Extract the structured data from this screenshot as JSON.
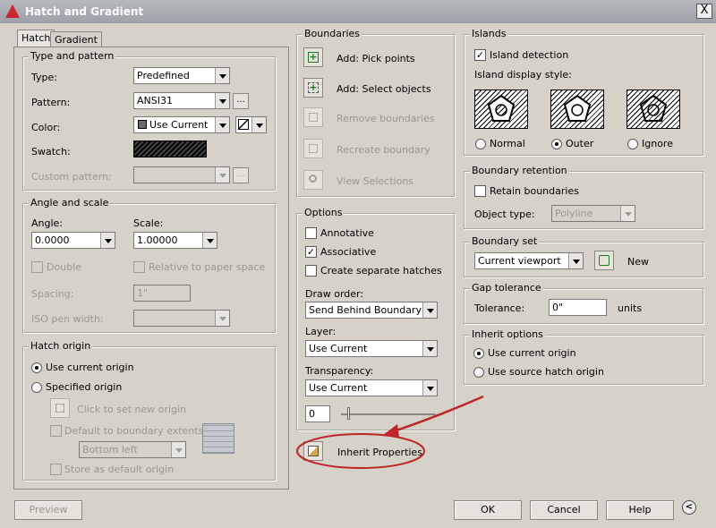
{
  "window": {
    "title": "Hatch and Gradient",
    "close": "X"
  },
  "tabs": [
    "Hatch",
    "Gradient"
  ],
  "type_pattern": {
    "group_label": "Type and pattern",
    "type_label": "Type:",
    "type_value": "Predefined",
    "pattern_label": "Pattern:",
    "pattern_value": "ANSI31",
    "color_label": "Color:",
    "color_value": "Use Current",
    "swatch_label": "Swatch:",
    "custom_label": "Custom pattern:",
    "ellipsis": "..."
  },
  "angle_scale": {
    "group_label": "Angle and scale",
    "angle_label": "Angle:",
    "angle_value": "0.0000",
    "scale_label": "Scale:",
    "scale_value": "1.00000",
    "double_label": "Double",
    "relative_label": "Relative to paper space",
    "spacing_label": "Spacing:",
    "spacing_value": "1\"",
    "iso_label": "ISO pen width:"
  },
  "hatch_origin": {
    "group_label": "Hatch origin",
    "use_current": "Use current origin",
    "specified": "Specified origin",
    "click_set": "Click to set new origin",
    "default_extents": "Default to boundary extents",
    "extents_value": "Bottom left",
    "store_default": "Store as default origin"
  },
  "boundaries": {
    "group_label": "Boundaries",
    "add_pick": "Add: Pick points",
    "add_select": "Add: Select objects",
    "remove": "Remove boundaries",
    "recreate": "Recreate boundary",
    "view": "View Selections"
  },
  "options": {
    "group_label": "Options",
    "annotative": "Annotative",
    "associative": "Associative",
    "separate": "Create separate hatches",
    "draw_order_label": "Draw order:",
    "draw_order_value": "Send Behind Boundary",
    "layer_label": "Layer:",
    "layer_value": "Use Current",
    "transparency_label": "Transparency:",
    "transparency_value": "Use Current",
    "transparency_amount": "0"
  },
  "inherit_button": "Inherit Properties",
  "islands": {
    "group_label": "Islands",
    "detection": "Island detection",
    "style_label": "Island display style:",
    "normal": "Normal",
    "outer": "Outer",
    "ignore": "Ignore"
  },
  "retention": {
    "group_label": "Boundary retention",
    "retain": "Retain boundaries",
    "object_type_label": "Object type:",
    "object_type_value": "Polyline"
  },
  "boundary_set": {
    "group_label": "Boundary set",
    "value": "Current viewport",
    "new_label": "New"
  },
  "gap": {
    "group_label": "Gap tolerance",
    "tolerance_label": "Tolerance:",
    "tolerance_value": "0\"",
    "units": "units"
  },
  "inherit_options": {
    "group_label": "Inherit options",
    "use_current": "Use current origin",
    "use_source": "Use source hatch origin"
  },
  "footer": {
    "preview": "Preview",
    "ok": "OK",
    "cancel": "Cancel",
    "help": "Help",
    "more": "<"
  },
  "colors": {
    "annotation": "#c0252b",
    "title_text": "#ffffff"
  },
  "icons": [
    "autocad-app-icon",
    "pick-points-icon",
    "select-objects-icon",
    "remove-boundaries-icon",
    "recreate-boundary-icon",
    "view-selections-icon",
    "inherit-properties-icon",
    "new-boundary-set-icon",
    "hatch-origin-preview-icon",
    "more-options-icon"
  ]
}
